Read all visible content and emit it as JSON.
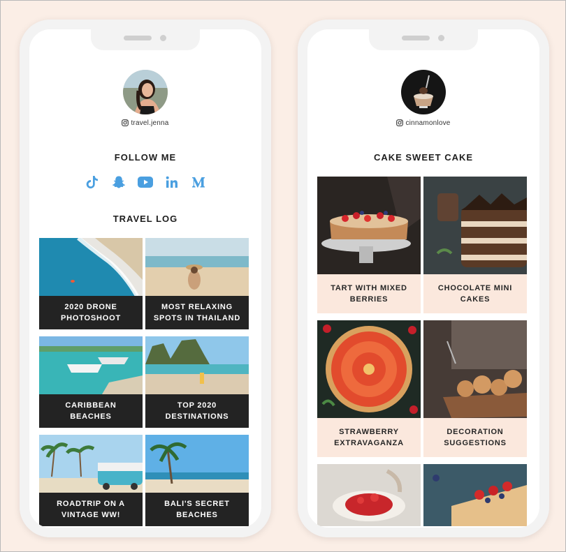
{
  "phone_left": {
    "handle": "travel.jenna",
    "follow_title": "FOLLOW ME",
    "socials": [
      "tiktok-icon",
      "snapchat-icon",
      "youtube-icon",
      "linkedin-icon",
      "medium-icon"
    ],
    "social_color": "#4a9fe0",
    "section_title": "TRAVEL LOG",
    "tiles": [
      {
        "caption": "2020 DRONE PHOTOSHOOT"
      },
      {
        "caption": "MOST RELAXING SPOTS IN THAILAND"
      },
      {
        "caption": "CARIBBEAN BEACHES"
      },
      {
        "caption": "TOP 2020 DESTINATIONS"
      },
      {
        "caption": "ROADTRIP ON A VINTAGE WW!"
      },
      {
        "caption": "BALI'S SECRET BEACHES"
      }
    ]
  },
  "phone_right": {
    "handle": "cinnamonlove",
    "section_title": "CAKE SWEET CAKE",
    "tiles": [
      {
        "caption": "TART WITH MIXED BERRIES"
      },
      {
        "caption": "CHOCOLATE MINI CAKES"
      },
      {
        "caption": "STRAWBERRY EXTRAVAGANZA"
      },
      {
        "caption": "DECORATION SUGGESTIONS"
      }
    ]
  },
  "colors": {
    "background": "#fbeee6",
    "dark_caption": "#232323",
    "light_caption": "#fbe8dd"
  }
}
